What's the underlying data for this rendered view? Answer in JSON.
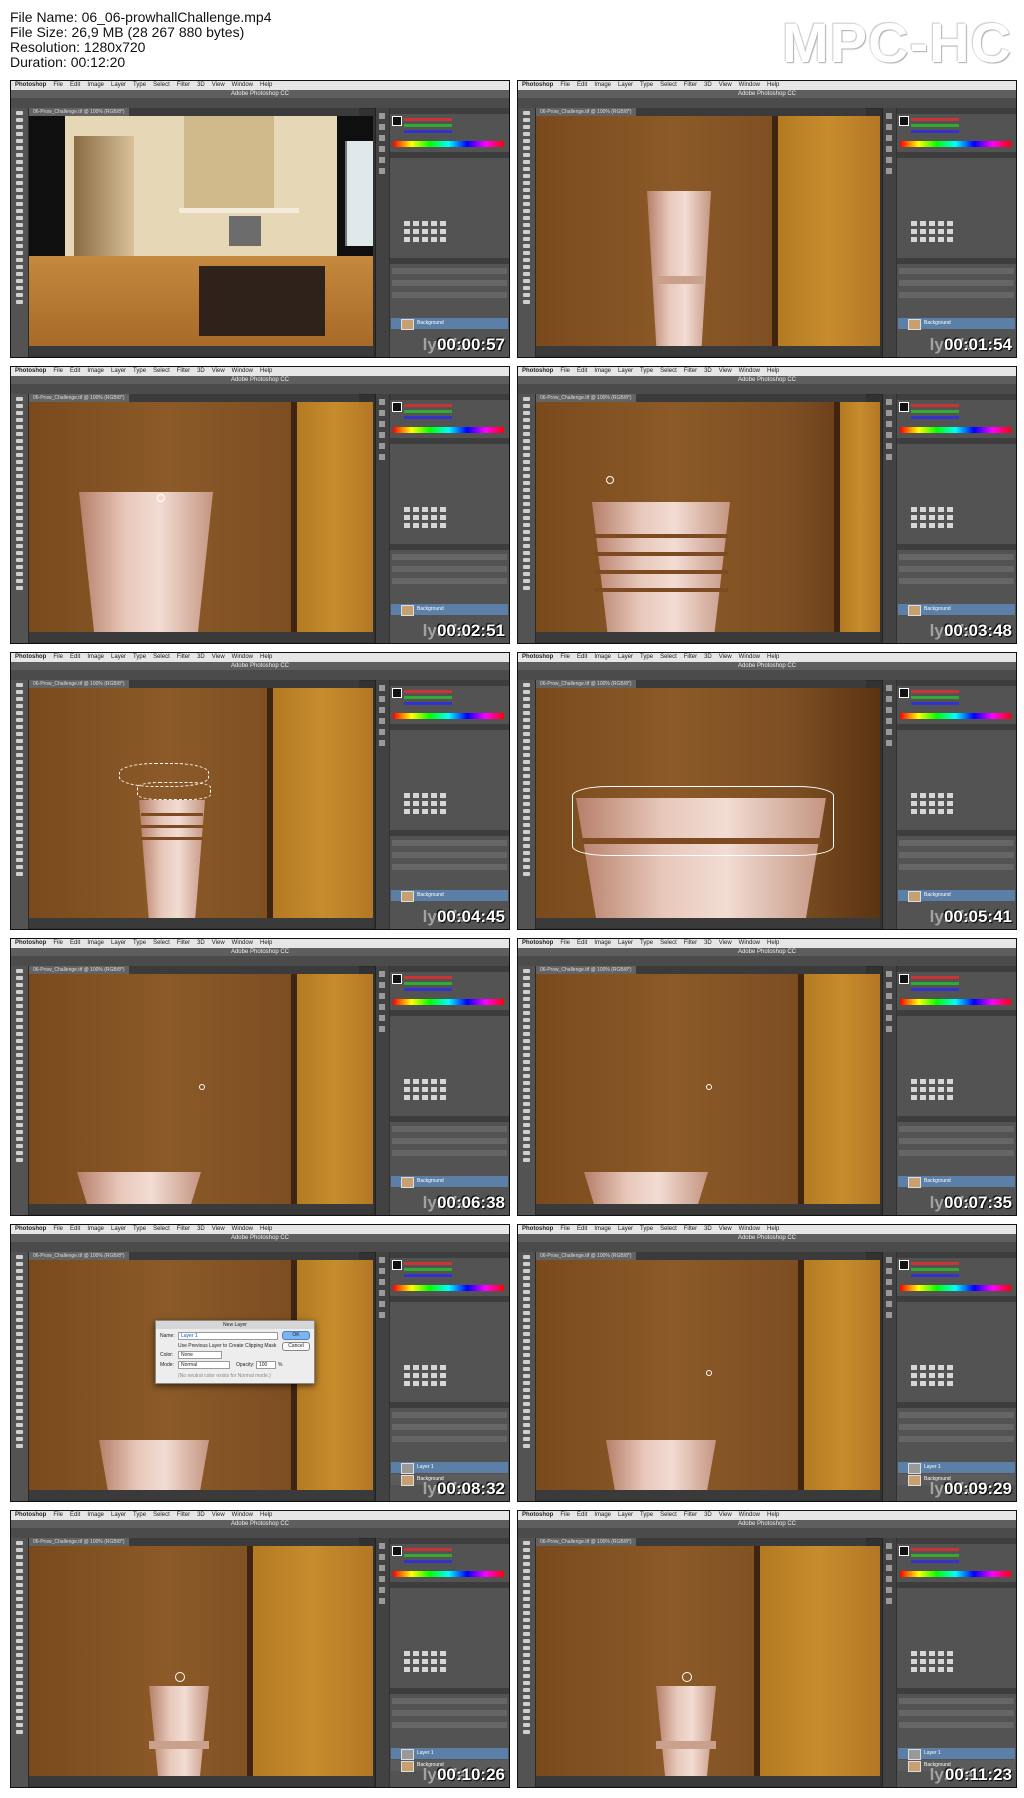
{
  "info": {
    "file_name": "File Name: 06_06-prowhallChallenge.mp4",
    "file_size": "File Size: 26,9 MB (28 267 880 bytes)",
    "resolution": "Resolution: 1280x720",
    "duration": "Duration: 00:12:20"
  },
  "brand": "MPC-HC",
  "app": {
    "menu": [
      "Photoshop",
      "File",
      "Edit",
      "Image",
      "Layer",
      "Type",
      "Select",
      "Filter",
      "3D",
      "View",
      "Window",
      "Help"
    ],
    "window_title": "Adobe Photoshop CC",
    "doc_tab": "06-Prow_Challenge.tif @ 100% (RGB/8*)",
    "layer_name": "Background",
    "new_layer_name": "Layer 1",
    "watermark": "lynda"
  },
  "dialog": {
    "title": "New Layer",
    "name_label": "Name:",
    "name_value": "Layer 1",
    "ok": "OK",
    "cancel": "Cancel",
    "clip_option": "Use Previous Layer to Create Clipping Mask",
    "color_label": "Color:",
    "color_value": "None",
    "mode_label": "Mode:",
    "mode_value": "Normal",
    "opacity_label": "Opacity:",
    "opacity_value": "100",
    "opacity_unit": "%",
    "note": "(No neutral color exists for Normal mode.)"
  },
  "thumbnails": [
    {
      "time": "00:00:57",
      "scene": "room"
    },
    {
      "time": "00:01:54",
      "scene": "vase-top"
    },
    {
      "time": "00:02:51",
      "scene": "vase-large"
    },
    {
      "time": "00:03:48",
      "scene": "vase-bands"
    },
    {
      "time": "00:04:45",
      "scene": "vase-select"
    },
    {
      "time": "00:05:41",
      "scene": "vase-zoom"
    },
    {
      "time": "00:06:38",
      "scene": "wall-bottom"
    },
    {
      "time": "00:07:35",
      "scene": "wall-bottom"
    },
    {
      "time": "00:08:32",
      "scene": "dialog"
    },
    {
      "time": "00:09:29",
      "scene": "wall-bottom2"
    },
    {
      "time": "00:10:26",
      "scene": "vase-small"
    },
    {
      "time": "00:11:23",
      "scene": "vase-small"
    }
  ]
}
